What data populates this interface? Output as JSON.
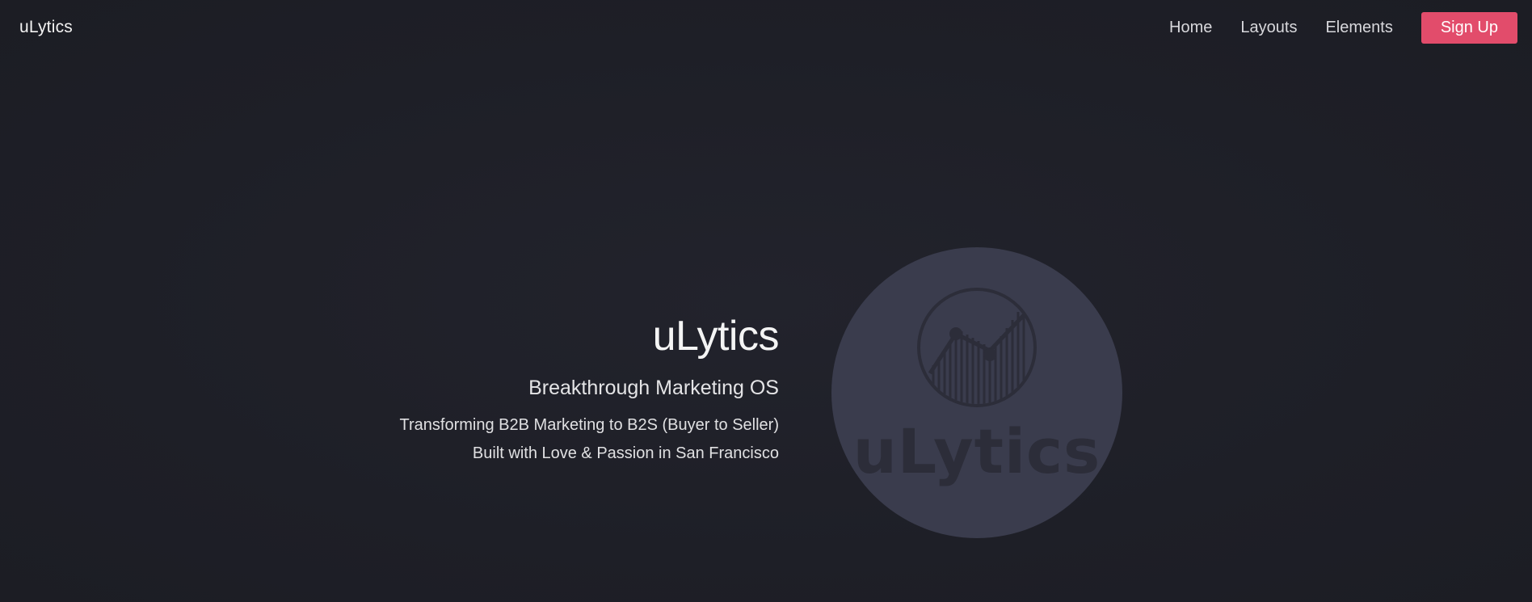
{
  "navbar": {
    "brand": "uLytics",
    "links": [
      {
        "label": "Home"
      },
      {
        "label": "Layouts"
      },
      {
        "label": "Elements"
      }
    ],
    "signup_label": "Sign Up"
  },
  "hero": {
    "title": "uLytics",
    "subtitle": "Breakthrough Marketing OS",
    "line1": "Transforming B2B Marketing to B2S (Buyer to Seller)",
    "line2": "Built with Love & Passion in San Francisco",
    "logo_text": "uLytics",
    "logo_icon": "analytics-chart-icon"
  },
  "colors": {
    "background": "#1e1f27",
    "accent": "#e24c6b",
    "logo_circle": "#3a3c4d",
    "logo_mark": "#2c2d39"
  }
}
